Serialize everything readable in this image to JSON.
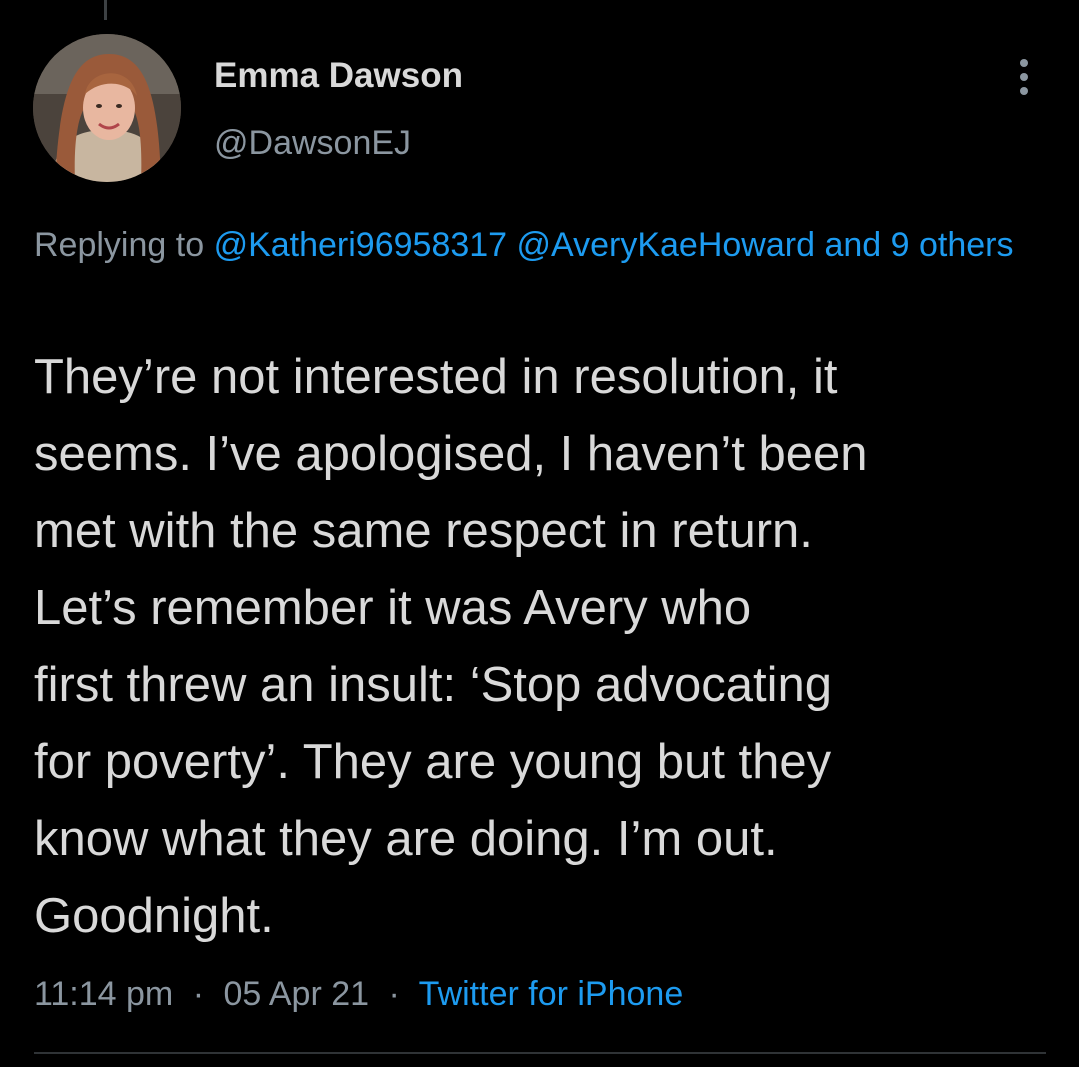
{
  "tweet": {
    "author": {
      "name": "Emma Dawson",
      "handle": "@DawsonEJ",
      "avatar_icon": "profile-photo"
    },
    "more_icon": "vertical-ellipsis-icon",
    "reply_context": {
      "prefix": "Replying to",
      "mentions": [
        "@Katheri96958317",
        "@AveryKaeHoward"
      ],
      "joiner": "and",
      "others": "9 others"
    },
    "text_lines": [
      "They’re not interested in resolution, it",
      "seems. I’ve apologised, I haven’t been",
      "met with the same respect in return.",
      "Let’s remember it was Avery who",
      "first threw an insult: ‘Stop advocating",
      "for poverty’. They are young but they",
      "know what they are doing. I’m out.",
      "Goodnight."
    ],
    "time": "11:14 pm",
    "separator": "·",
    "date": "05 Apr 21",
    "source": "Twitter for iPhone"
  },
  "colors": {
    "background": "#000000",
    "primary_text": "#d9d9d9",
    "secondary_text": "#8b96a0",
    "accent": "#1d9bf0",
    "divider": "#2f3336"
  }
}
